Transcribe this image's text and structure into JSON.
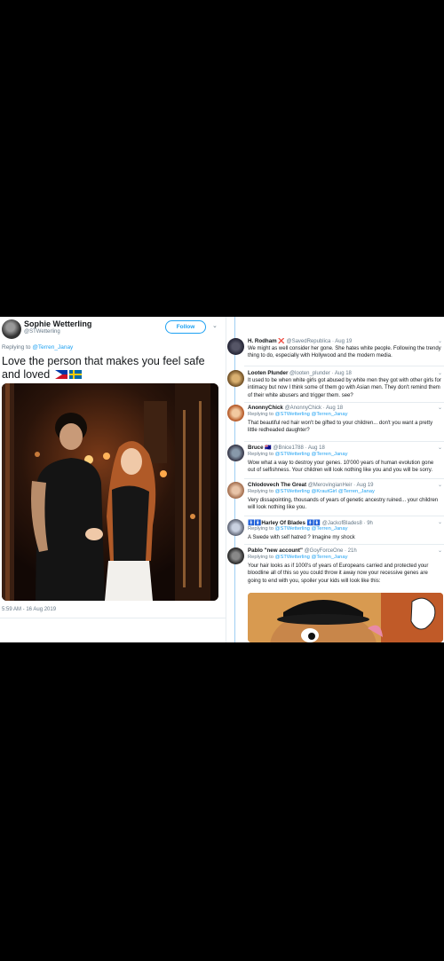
{
  "main_tweet": {
    "name": "Sophie Wetterling",
    "handle": "@STWetterling",
    "follow_label": "Follow",
    "replying_prefix": "Replying to ",
    "replying_to": "@Terren_Janay",
    "text": "Love the person that makes you feel safe and loved",
    "flags": [
      "flag-philippines",
      "flag-sweden"
    ],
    "timestamp": "5:59 AM - 16 Aug 2019",
    "icons": {
      "menu": "chevron-down-icon"
    }
  },
  "replies": [
    {
      "name": "H. Rodham",
      "badge": "❌",
      "handle": "@SavedRepublica",
      "date": "· Aug 19",
      "replying_to": "",
      "text": "We might as well consider her gone. She hates white people. Following the trendy thing to do, especially with Hollywood and the modern media."
    },
    {
      "name": "Looten Plunder",
      "badge": "",
      "handle": "@looten_plunder",
      "date": "· Aug 18",
      "replying_to": "",
      "text": "It used to be when white girls got abused by white men they got with other girls for intimacy but now I think some of them go with Asian men.  They don't remind them of their white abusers and trigger them. see?"
    },
    {
      "name": "AnonnyChick",
      "badge": "",
      "handle": "@AnonnyChick",
      "date": "· Aug 18",
      "replying_to": "@STWetterling @Terren_Janay",
      "text": "That beautiful red hair won't be gifted to your children... don't you want a pretty little redheaded daughter?"
    },
    {
      "name": "Bruce",
      "badge": "🇦🇺",
      "handle": "@Bnice1788",
      "date": "· Aug 18",
      "replying_to": "@STWetterling @Terren_Janay",
      "text": "Wow what a way to destroy your genes. 10'000 years of human evolution gone out of selfishness. Your children will look nothing like you and you will be sorry."
    },
    {
      "name": "Chlodovech The Great",
      "badge": "",
      "handle": "@MerovingianHeir",
      "date": "· Aug 19",
      "replying_to": "@STWetterling @KrautGirl @Terren_Janay",
      "text": "Very dissapointing, thousands of years of genetic ancestry ruined... your children will look nothing like you."
    },
    {
      "name": "🚹🚺Harley Of Blades 🚹🚺",
      "badge": "",
      "handle": "@JackofBlades8",
      "date": "· 9h",
      "replying_to": "@STWetterling @Terren_Janay",
      "text": "A Swede with self hatred ? Imagine my shock"
    },
    {
      "name": "Pablo \"new account\"",
      "badge": "",
      "handle": "@GoyForceOne",
      "date": "· 21h",
      "replying_to": "@STWetterling @Terren_Janay",
      "text": "Your hair looks as if 1000's of years of Europeans carried and protected your bloodline all of this so you could throw it away now your recessive genes are going to end with you, spoiler your kids will look like this:"
    }
  ],
  "reply_replying_prefix": "Replying to ",
  "colors": {
    "accent": "#1da1f2",
    "text": "#14171a",
    "muted": "#657786",
    "thread": "#9fcff3"
  }
}
